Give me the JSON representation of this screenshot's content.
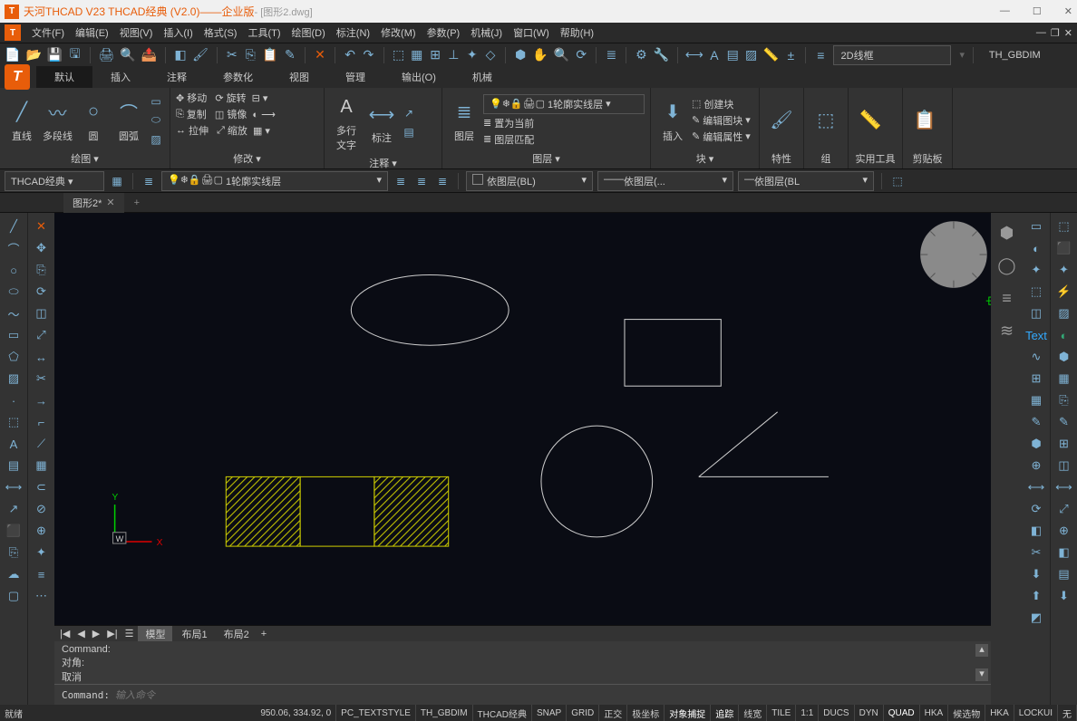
{
  "titlebar": {
    "title": "天河THCAD V23 THCAD经典 (V2.0)——企业版",
    "doc": " - [图形2.dwg]"
  },
  "menu": {
    "items": [
      "文件(F)",
      "编辑(E)",
      "视图(V)",
      "插入(I)",
      "格式(S)",
      "工具(T)",
      "绘图(D)",
      "标注(N)",
      "修改(M)",
      "参数(P)",
      "机械(J)",
      "窗口(W)",
      "帮助(H)"
    ]
  },
  "quickbar": {
    "view_style": "2D线框",
    "dim_style": "TH_GBDIM"
  },
  "ribbon": {
    "tabs": [
      "默认",
      "插入",
      "注释",
      "参数化",
      "视图",
      "管理",
      "输出(O)",
      "机械"
    ],
    "active": 0,
    "draw": {
      "line": "直线",
      "pline": "多段线",
      "circle": "圆",
      "arc": "圆弧",
      "label": "绘图 ▾"
    },
    "modify": {
      "move": "移动",
      "rotate": "旋转",
      "copy": "复制",
      "mirror": "镜像",
      "stretch": "拉伸",
      "scale": "缩放",
      "label": "修改 ▾"
    },
    "annot": {
      "mtext": "多行\n文字",
      "dim": "标注",
      "label": "注释 ▾"
    },
    "layer": {
      "btn": "图层",
      "current": "1轮廓实线层",
      "setcur": "置为当前",
      "match": "图层匹配",
      "label": "图层 ▾"
    },
    "block": {
      "insert": "插入",
      "create": "创建块",
      "edit": "编辑图块",
      "attr": "编辑属性",
      "label": "块 ▾"
    },
    "props": {
      "label": "特性"
    },
    "group": {
      "label": "组"
    },
    "util": {
      "label": "实用工具"
    },
    "clip": {
      "label": "剪贴板"
    }
  },
  "propbar": {
    "workspace": "THCAD经典",
    "layer": "1轮廓实线层",
    "color": "依图层(BL)",
    "ltype": "依图层(...",
    "lweight": "依图层(BL"
  },
  "doctab": {
    "name": "图形2*"
  },
  "layout": {
    "tabs": [
      "模型",
      "布局1",
      "布局2"
    ],
    "active": 0
  },
  "cmd": {
    "history": [
      "Command:",
      "对角:",
      "取消"
    ],
    "prompt": "Command:",
    "placeholder": "输入命令"
  },
  "status": {
    "ready": "就绪",
    "coords": "950.06, 334.92, 0",
    "textstyle": "PC_TEXTSTYLE",
    "dimstyle": "TH_GBDIM",
    "ws": "THCAD经典",
    "items": [
      "SNAP",
      "GRID",
      "正交",
      "极坐标",
      "对象捕捉",
      "追踪",
      "线宽",
      "TILE",
      "1:1",
      "DUCS",
      "DYN",
      "QUAD",
      "HKA",
      "候选物",
      "HKA",
      "LOCKUI",
      "无"
    ]
  }
}
